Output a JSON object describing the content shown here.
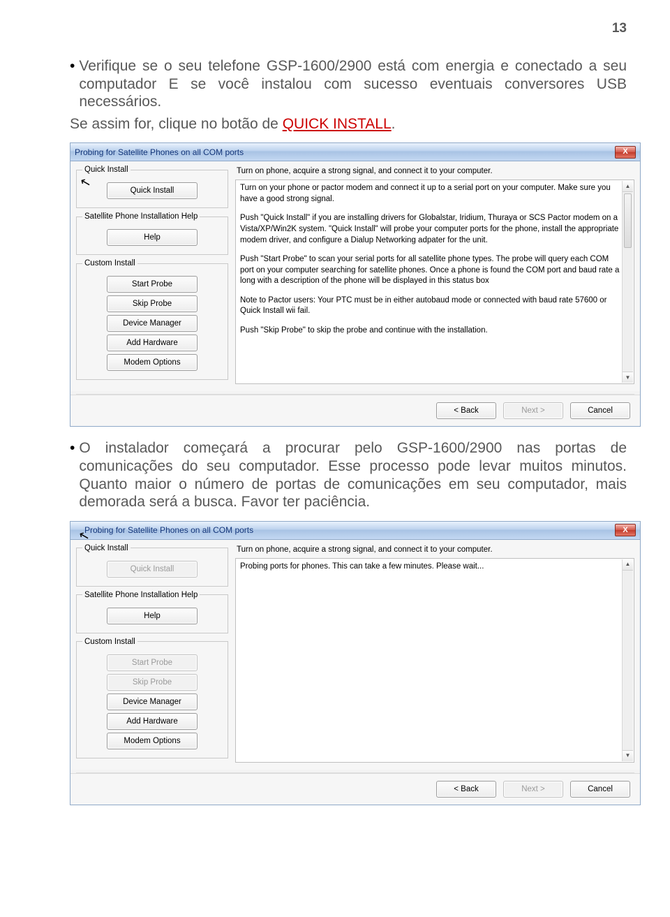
{
  "page_number": "13",
  "para1": "Verifique se o seu telefone GSP-1600/2900 está com energia e conectado a seu computador E se você instalou com sucesso eventuais conversores USB necessários.",
  "para2_prefix": "Se assim for, clique no botão de ",
  "para2_link": "QUICK INSTALL",
  "para2_suffix": ".",
  "para3": "O instalador começará a procurar pelo GSP-1600/2900 nas portas de comunicações do seu computador. Esse processo pode levar muitos minutos. Quanto maior o número de portas de comunicações em seu computador, mais demorada será a busca. Favor ter paciência.",
  "dialog": {
    "title": "Probing for Satellite Phones on all COM ports",
    "close": "X",
    "groups": {
      "quick": "Quick Install",
      "help": "Satellite Phone Installation Help",
      "custom": "Custom Install"
    },
    "buttons": {
      "quick_install": "Quick Install",
      "help": "Help",
      "start_probe": "Start Probe",
      "skip_probe": "Skip Probe",
      "device_manager": "Device Manager",
      "add_hardware": "Add Hardware",
      "modem_options": "Modem Options"
    },
    "instruction": "Turn on phone,  acquire a strong signal, and connect it to your computer.",
    "info_paragraphs": [
      "Turn on your phone or pactor modem and connect it up to a serial port on your computer. Make sure you have a good strong signal.",
      "Push \"Quick Install\" if you are installing drivers for Globalstar, Iridium, Thuraya or SCS Pactor modem on a Vista/XP/Win2K system. \"Quick Install\" will probe your computer ports for the phone, install the appropriate modem driver, and configure a Dialup Networking adpater for the unit.",
      "Push \"Start Probe\" to scan your serial ports for all satellite phone types. The probe will query each COM port on your computer searching for satellite phones. Once a phone is found the COM port and baud rate a long with a description of the phone will be displayed in this status box",
      "Note to Pactor users: Your PTC must be in either autobaud mode or connected with baud rate 57600 or Quick Install wii fail.",
      "Push \"Skip Probe\" to skip the probe and continue with the installation."
    ],
    "footer": {
      "back": "< Back",
      "next": "Next >",
      "cancel": "Cancel"
    }
  },
  "dialog2": {
    "info_text": "Probing ports for phones. This can take a few minutes. Please wait..."
  }
}
